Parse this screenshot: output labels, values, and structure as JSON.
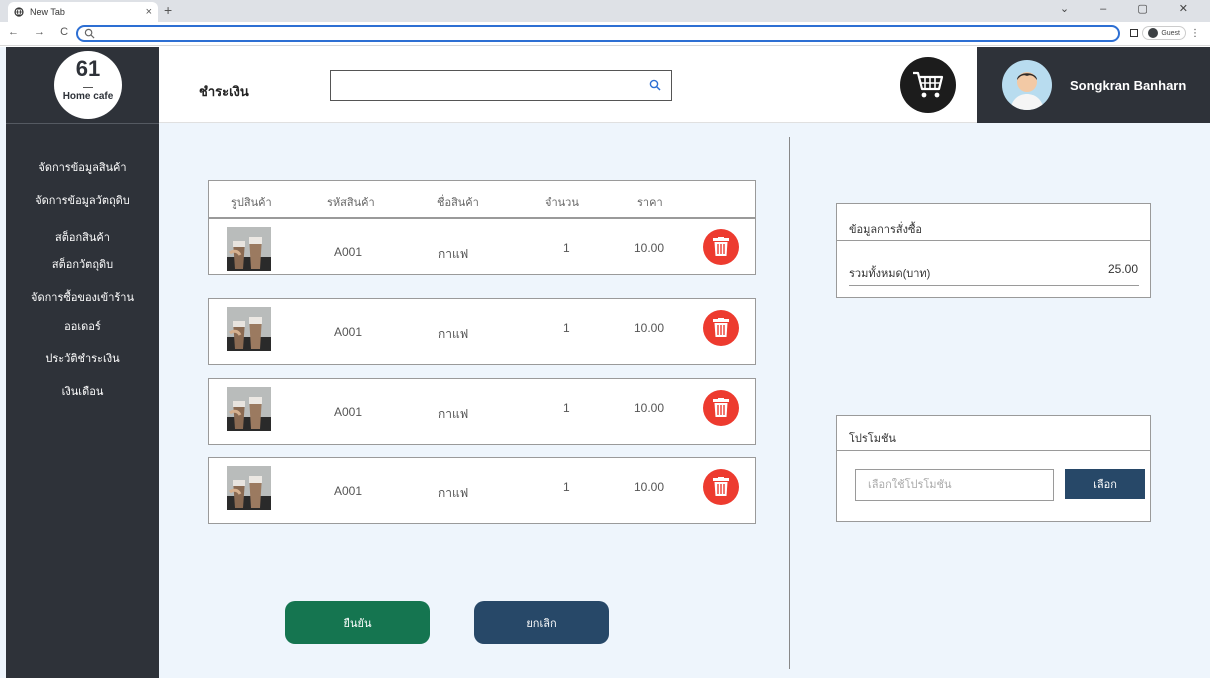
{
  "browser": {
    "tab_title": "New Tab",
    "tab_close": "×",
    "new_tab": "+",
    "nav": "← → C",
    "window_controls": "⌄ – ▢ ✕",
    "guest_label": "Guest",
    "menu": "⋮"
  },
  "logo": {
    "number": "61",
    "name": "Home cafe"
  },
  "sidebar": {
    "items": [
      {
        "label": "จัดการข้อมูลสินค้า"
      },
      {
        "label": "จัดการข้อมูลวัตถุดิบ"
      },
      {
        "label": "สต็อกสินค้า"
      },
      {
        "label": "สต็อกวัตถุดิบ"
      },
      {
        "label": "จัดการซื้อของเข้าร้าน"
      },
      {
        "label": "ออเดอร์"
      },
      {
        "label": "ประวัติชำระเงิน"
      },
      {
        "label": "เงินเดือน"
      }
    ]
  },
  "header": {
    "title": "ชำระเงิน",
    "search_value": "",
    "user_name": "Songkran Banharn"
  },
  "table": {
    "columns": [
      "รูปสินค้า",
      "รหัสสินค้า",
      "ชื่อสินค้า",
      "จำนวน",
      "ราคา"
    ],
    "rows": [
      {
        "code": "A001",
        "name": "กาแฟ",
        "qty": "1",
        "price": "10.00"
      },
      {
        "code": "A001",
        "name": "กาแฟ",
        "qty": "1",
        "price": "10.00"
      },
      {
        "code": "A001",
        "name": "กาแฟ",
        "qty": "1",
        "price": "10.00"
      },
      {
        "code": "A001",
        "name": "กาแฟ",
        "qty": "1",
        "price": "10.00"
      }
    ]
  },
  "actions": {
    "confirm": "ยืนยัน",
    "cancel": "ยกเลิก"
  },
  "order": {
    "title": "ข้อมูลการสั่งซื้อ",
    "total_label": "รวมทั้งหมด(บาท)",
    "total_value": "25.00"
  },
  "promotion": {
    "title": "โปรโมชัน",
    "placeholder": "เลือกใช้โปรโมชัน",
    "button": "เลือก"
  },
  "colors": {
    "sidebar": "#2e3239",
    "confirm": "#157550",
    "cancel": "#274868",
    "delete": "#ed3b2f",
    "background": "#eef5fc"
  }
}
